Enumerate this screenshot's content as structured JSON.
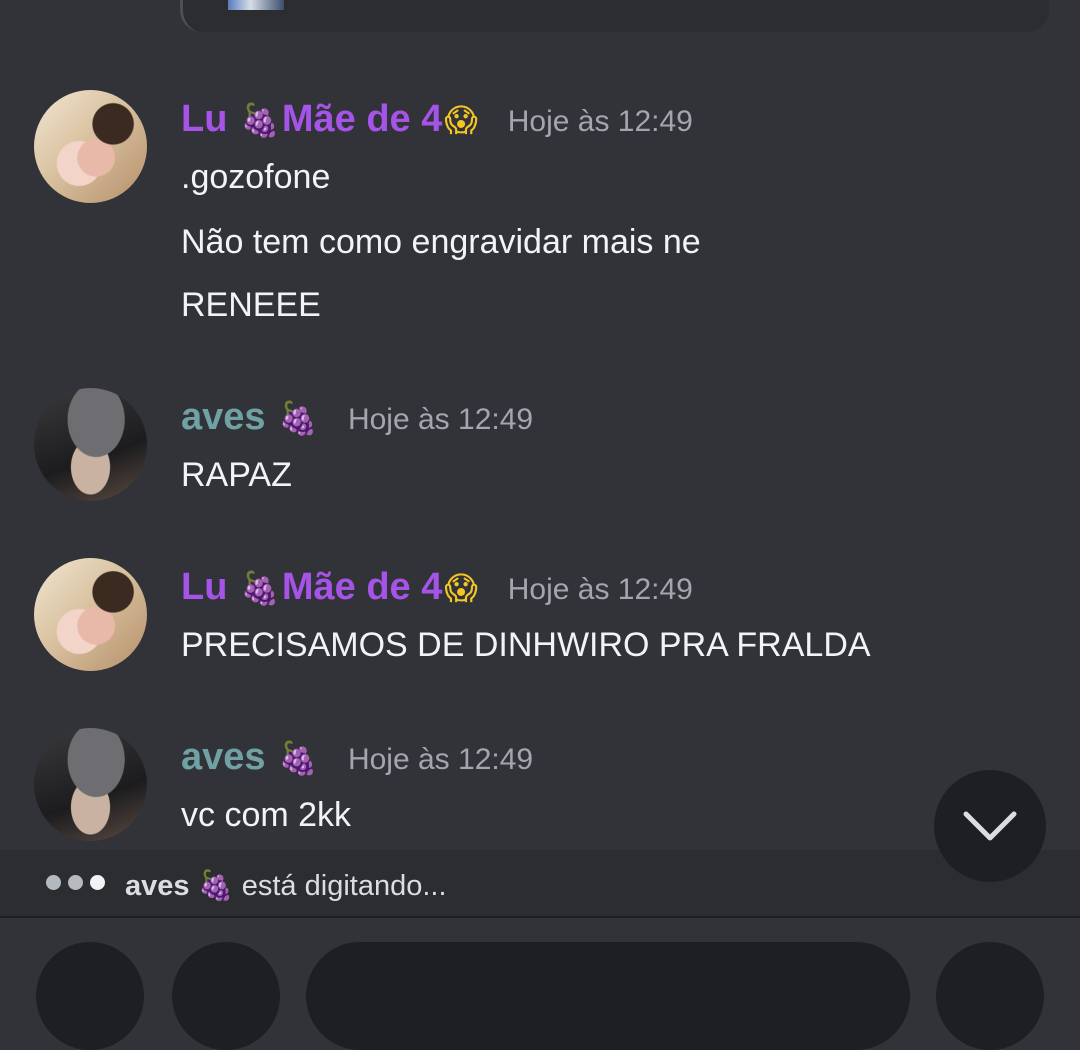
{
  "messages": [
    {
      "author": "Lu",
      "name_suffix": "Mãe de 4",
      "time": "Hoje às 12:49",
      "lines": [
        ".gozofone",
        "Não tem como engravidar mais ne",
        "RENEEE"
      ]
    },
    {
      "author": "aves",
      "time": "Hoje às 12:49",
      "lines": [
        "RAPAZ"
      ]
    },
    {
      "author": "Lu",
      "name_suffix": "Mãe de 4",
      "time": "Hoje às 12:49",
      "lines": [
        "PRECISAMOS DE DINHWIRO PRA FRALDA"
      ]
    },
    {
      "author": "aves",
      "time": "Hoje às 12:49",
      "lines": [
        "vc com 2kk"
      ]
    }
  ],
  "typing": {
    "user": "aves",
    "text": "está digitando..."
  },
  "emojis": {
    "grapes": "🍇",
    "scream": "😱"
  },
  "colors": {
    "background": "#313338",
    "lu_name": "#a653e8",
    "aves_name": "#6fa1a5",
    "timestamp": "#a2a6ad",
    "message_text": "#f2f3f5"
  },
  "icons": [
    "chevron-down-icon",
    "typing-dots-icon"
  ]
}
